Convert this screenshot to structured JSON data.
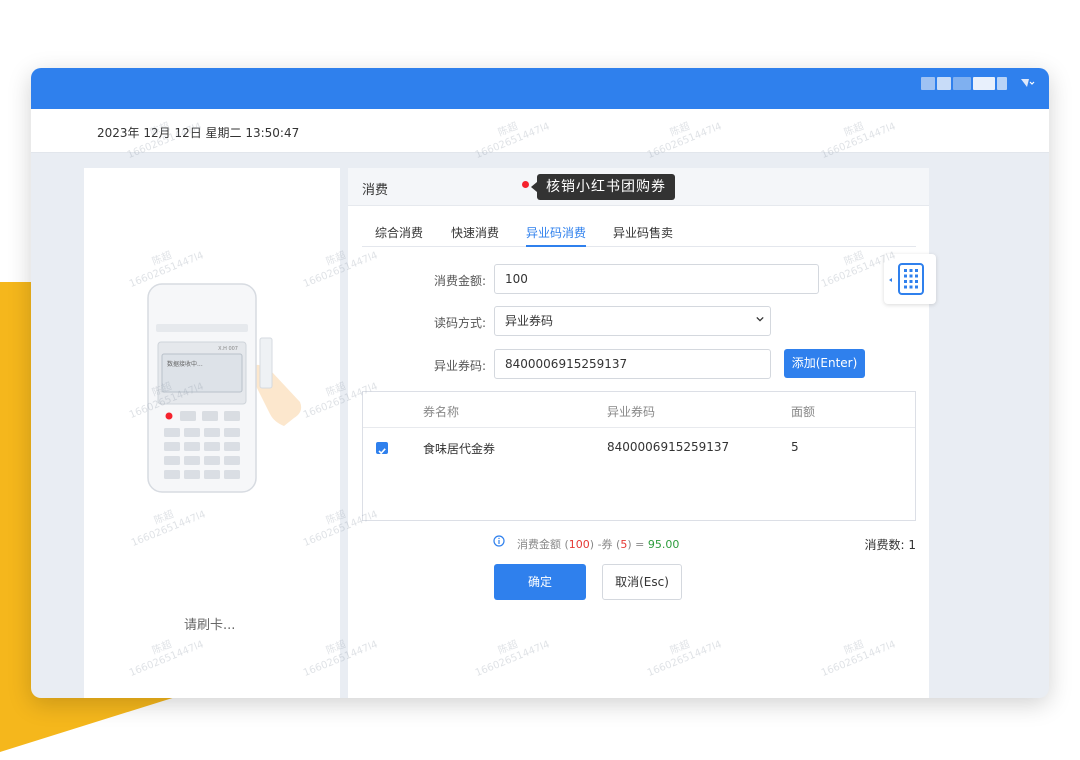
{
  "datetime": "2023年 12月 12日  星期二  13:50:47",
  "card_reader": {
    "screen_label": "X.H 007",
    "screen_text": "数据接收中...",
    "prompt": "请刷卡..."
  },
  "panel": {
    "title": "消费",
    "tooltip": "核销小红书团购券"
  },
  "tabs": [
    {
      "label": "综合消费",
      "active": false
    },
    {
      "label": "快速消费",
      "active": false
    },
    {
      "label": "异业码消费",
      "active": true
    },
    {
      "label": "异业码售卖",
      "active": false
    }
  ],
  "form": {
    "amount_label": "消费金额:",
    "amount_value": "100",
    "read_mode_label": "读码方式:",
    "read_mode_value": "异业券码",
    "code_label": "异业券码:",
    "code_value": "8400006915259137",
    "add_button": "添加(Enter)"
  },
  "table": {
    "headers": [
      "券名称",
      "异业券码",
      "面额"
    ],
    "rows": [
      {
        "checked": true,
        "name": "食味居代金券",
        "code": "8400006915259137",
        "value": "5"
      }
    ]
  },
  "summary": {
    "prefix": "消费金额 (",
    "amount": "100",
    "mid": ") -券 (",
    "coupon": "5",
    "suffix": ") = ",
    "result": "95.00",
    "count_label": "消费数: 1"
  },
  "buttons": {
    "confirm": "确定",
    "cancel": "取消(Esc)"
  },
  "watermark": {
    "name": "陈超",
    "phone": "16602651447l4"
  },
  "colors": {
    "primary": "#2f80ed",
    "accent_yellow": "#f5b71c",
    "red": "#e53935",
    "green": "#2e9d3e"
  }
}
